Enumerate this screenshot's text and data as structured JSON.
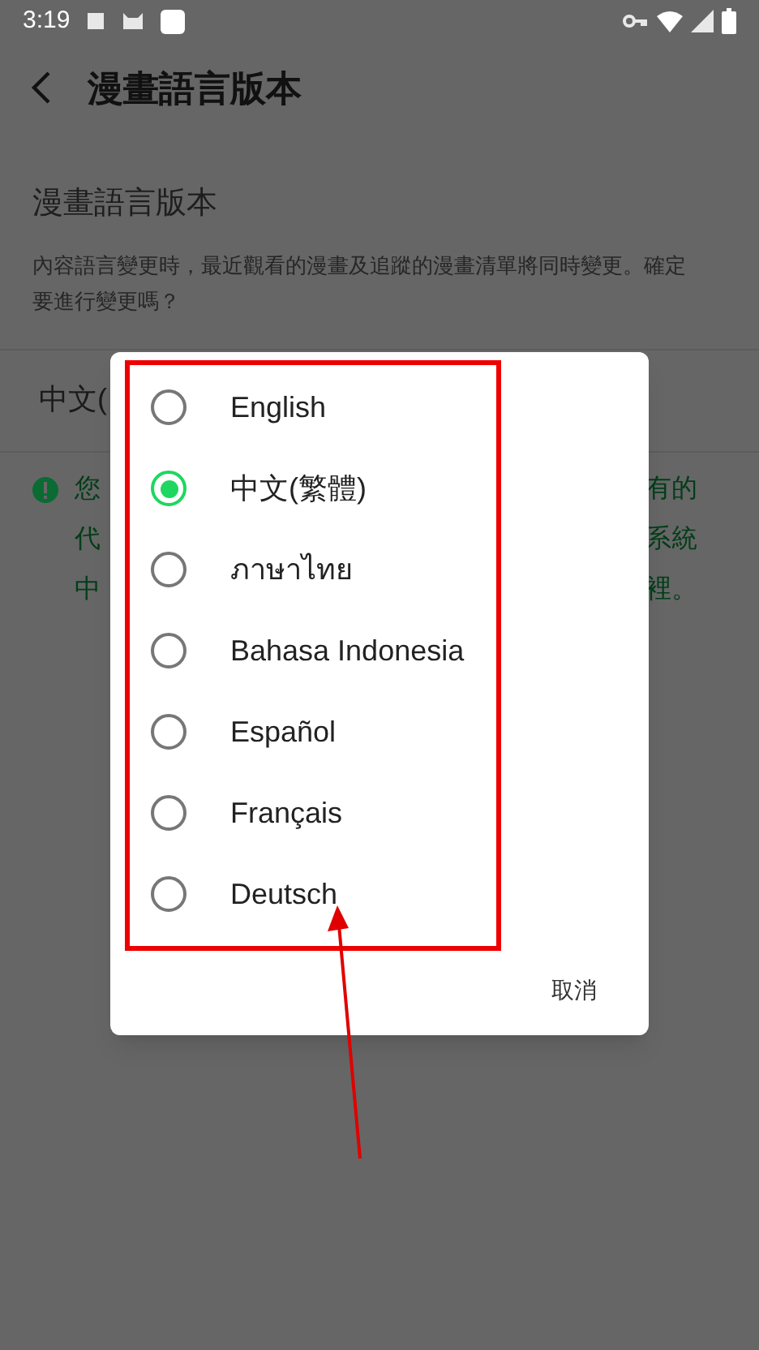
{
  "status_bar": {
    "time": "3:19"
  },
  "header": {
    "title": "漫畫語言版本"
  },
  "section": {
    "title": "漫畫語言版本",
    "description": "內容語言變更時，最近觀看的漫畫及追蹤的漫畫清單將同時變更。確定要進行變更嗎？"
  },
  "current_value": "中文(",
  "notice_lines": [
    {
      "left": "您",
      "right": "有的"
    },
    {
      "left": "代",
      "right": "系統"
    },
    {
      "left": "中",
      "right": "裡。"
    }
  ],
  "dialog": {
    "options": [
      {
        "label": "English",
        "selected": false
      },
      {
        "label": "中文(繁體)",
        "selected": true
      },
      {
        "label": "ภาษาไทย",
        "selected": false
      },
      {
        "label": "Bahasa Indonesia",
        "selected": false
      },
      {
        "label": "Español",
        "selected": false
      },
      {
        "label": "Français",
        "selected": false
      },
      {
        "label": "Deutsch",
        "selected": false
      }
    ],
    "cancel": "取消"
  }
}
